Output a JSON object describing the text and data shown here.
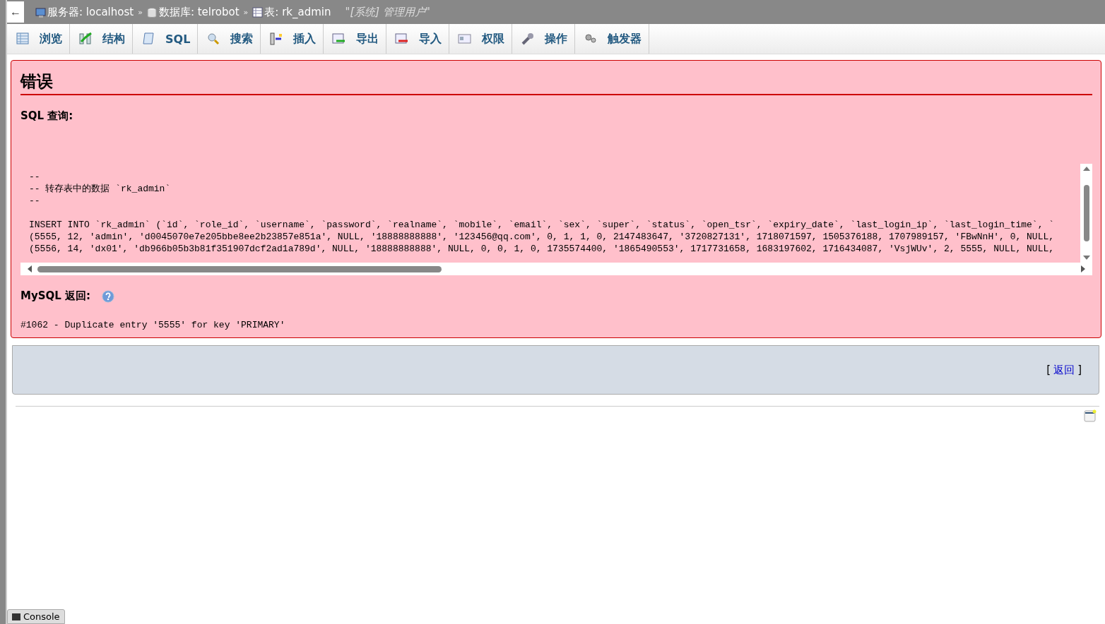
{
  "top_bar": {
    "back_button": "←",
    "breadcrumbs": [
      {
        "kind": "server",
        "label": "服务器: localhost"
      },
      {
        "kind": "database",
        "label": "数据库: telrobot"
      },
      {
        "kind": "table",
        "label": "表: rk_admin"
      }
    ],
    "separator": "»",
    "comment": "\"[系统] 管理用户\""
  },
  "tabs": [
    {
      "kind": "browse",
      "label": "浏览",
      "selected": false
    },
    {
      "kind": "structure",
      "label": "结构",
      "selected": false
    },
    {
      "kind": "sql",
      "label": "SQL",
      "selected": false
    },
    {
      "kind": "search",
      "label": "搜索",
      "selected": false
    },
    {
      "kind": "insert",
      "label": "插入",
      "selected": false
    },
    {
      "kind": "export",
      "label": "导出",
      "selected": false
    },
    {
      "kind": "import",
      "label": "导入",
      "selected": false
    },
    {
      "kind": "privileges",
      "label": "权限",
      "selected": false
    },
    {
      "kind": "operations",
      "label": "操作",
      "selected": false
    },
    {
      "kind": "triggers",
      "label": "触发器",
      "selected": false
    }
  ],
  "error": {
    "title": "错误",
    "query_label": "SQL 查询:",
    "comment_lines": [
      "--",
      "-- 转存表中的数据 `rk_admin`",
      "--"
    ],
    "insert_lines": [
      "INSERT INTO `rk_admin` (`id`, `role_id`, `username`, `password`, `realname`, `mobile`, `email`, `sex`, `super`, `status`, `open_tsr`, `expiry_date`, `last_login_ip`, `last_login_time`, `",
      "(5555, 12, 'admin', 'd0045070e7e205bbe8ee2b23857e851a', NULL, '18888888888', '123456@qq.com', 0, 1, 1, 0, 2147483647, '3720827131', 1718071597, 1505376188, 1707989157, 'FBwNnH', 0, NULL,",
      "(5556, 14, 'dx01', 'db966b05b3b81f351907dcf2ad1a789d', NULL, '18888888888', NULL, 0, 0, 1, 0, 1735574400, '1865490553', 1717731658, 1683197602, 1716434087, 'VsjWUv', 2, 5555, NULL, NULL,"
    ],
    "response_label": "MySQL 返回:",
    "message": "#1062 - Duplicate entry '5555' for key 'PRIMARY'"
  },
  "footer": {
    "bracket_open": "[",
    "back_link": "返回",
    "bracket_close": "]"
  },
  "console": {
    "label": "Console"
  }
}
